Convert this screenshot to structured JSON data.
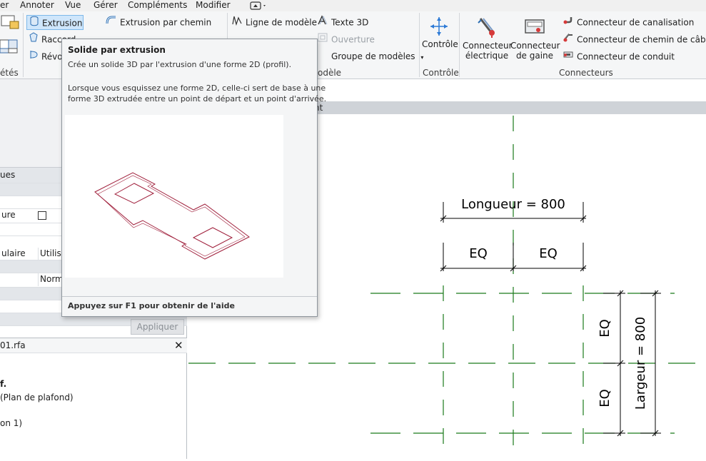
{
  "menubar": {
    "items": [
      "er",
      "Annoter",
      "Vue",
      "Gérer",
      "Compléments",
      "Modifier"
    ]
  },
  "ribbon": {
    "forms": {
      "extrusion": "Extrusion",
      "raccord": "Raccord",
      "revolution": "Révol",
      "group_label": "étés"
    },
    "path": {
      "extrusion_path": "Extrusion par chemin"
    },
    "model": {
      "model_line": "Ligne de modèle",
      "text3d": "Texte 3D",
      "opening": "Ouverture",
      "model_group": "Groupe de modèles",
      "group_label": "odèle"
    },
    "control": {
      "label": "Contrôle",
      "group_label": "Contrôle"
    },
    "connectors": {
      "electrical": [
        "Connecteur",
        "électrique"
      ],
      "duct": [
        "Connecteur",
        "de gaine"
      ],
      "pipe": "Connecteur de canalisation",
      "cable_tray": "Connecteur de chemin de câbles",
      "conduit": "Connecteur de conduit",
      "group_label": "Connecteurs"
    }
  },
  "tooltip": {
    "title": "Solide par extrusion",
    "description": "Crée un solide 3D par l'extrusion d'une forme 2D (profil).",
    "detail_line1": "Lorsque vous esquissez une forme 2D, celle-ci sert de base à une",
    "detail_line2": "forme 3D extrudée entre un point de départ et un point d'arrivée.",
    "footer": "Appuyez sur F1 pour obtenir de l'aide"
  },
  "properties": {
    "section_label": "ues",
    "row_ure": "ure",
    "row_ulaire": "ulaire",
    "row_utilise": "Utilise",
    "row_norm": "Norm",
    "apply_label": "Appliquer"
  },
  "browser": {
    "file_name": "01.rfa",
    "item_f": "f.",
    "item_plafond": "(Plan de plafond)",
    "item_on1": "on 1)"
  },
  "view": {
    "tab_fragment": "nt"
  },
  "drawing": {
    "longueur": "Longueur = 800",
    "eq_left": "EQ",
    "eq_right": "EQ",
    "eq_top": "EQ",
    "eq_bottom": "EQ",
    "largeur": "Largeur = 800"
  },
  "icons": {
    "window_icon": "window-icon",
    "extrusion": "extrusion-icon",
    "sweep": "sweep-icon",
    "model_line": "model-line-icon",
    "text3d": "text-3d-icon",
    "control": "control-arrows-icon",
    "electrical": "electrical-connector-icon",
    "duct": "duct-connector-icon",
    "pipe": "pipe-connector-icon",
    "cable_tray": "cable-tray-connector-icon",
    "conduit": "conduit-connector-icon",
    "close": "close-icon"
  },
  "colors": {
    "reference_plane": "#1a7a1a",
    "extrusion_outline": "#a0203c",
    "selected": "#cfe6fb"
  }
}
